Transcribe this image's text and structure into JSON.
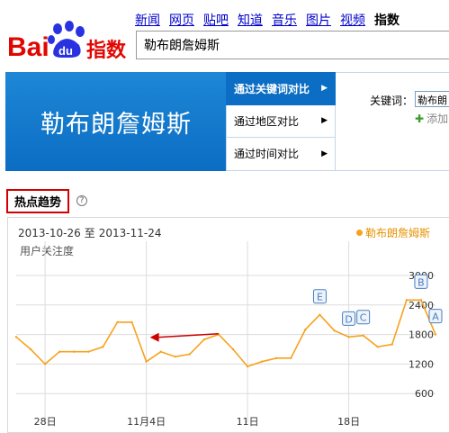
{
  "header": {
    "logo": {
      "bai": "Bai",
      "du": "du",
      "zhishu": "指数"
    },
    "nav": [
      "新闻",
      "网页",
      "贴吧",
      "知道",
      "音乐",
      "图片",
      "视频",
      "指数"
    ],
    "nav_current": "指数",
    "search_value": "勒布朗詹姆斯"
  },
  "banner": {
    "keyword": "勒布朗詹姆斯",
    "options": [
      "通过关键词对比",
      "通过地区对比",
      "通过时间对比"
    ],
    "kw_label": "关键词：",
    "kw_value": "勒布朗",
    "add_label": "添加"
  },
  "section": {
    "title": "热点趋势",
    "help": "?"
  },
  "chart_data": {
    "type": "line",
    "date_start": "2013-10-26",
    "date_sep": "至",
    "date_end": "2013-11-24",
    "ylabel": "用户关注度",
    "legend": "勒布朗詹姆斯",
    "ylim": [
      0,
      3000
    ],
    "yticks": [
      600,
      1200,
      1800,
      2400,
      3000
    ],
    "xtick_labels": [
      "28日",
      "11月4日",
      "11日",
      "18日"
    ],
    "xtick_index": [
      2,
      9,
      16,
      23
    ],
    "x": [
      "10-26",
      "10-27",
      "10-28",
      "10-29",
      "10-30",
      "10-31",
      "11-01",
      "11-02",
      "11-03",
      "11-04",
      "11-05",
      "11-06",
      "11-07",
      "11-08",
      "11-09",
      "11-10",
      "11-11",
      "11-12",
      "11-13",
      "11-14",
      "11-15",
      "11-16",
      "11-17",
      "11-18",
      "11-19",
      "11-20",
      "11-21",
      "11-22",
      "11-23",
      "11-24"
    ],
    "values": [
      1750,
      1500,
      1200,
      1450,
      1450,
      1450,
      1550,
      2050,
      2050,
      1250,
      1450,
      1350,
      1400,
      1700,
      1800,
      1500,
      1150,
      1250,
      1320,
      1320,
      1900,
      2200,
      1880,
      1750,
      1780,
      1550,
      1600,
      2500,
      2500,
      1800
    ],
    "annotations": [
      {
        "label": "E",
        "index": 21
      },
      {
        "label": "D",
        "index": 23
      },
      {
        "label": "C",
        "index": 24
      },
      {
        "label": "B",
        "index": 28
      },
      {
        "label": "A",
        "index": 29
      }
    ],
    "arrow": {
      "from_index": 14,
      "to_index": 9,
      "value": 1780
    },
    "colors": {
      "line": "#f7a21c",
      "grid": "#dcdcdc",
      "arrow": "#cc0000",
      "marker": "#4a7dbf"
    }
  }
}
